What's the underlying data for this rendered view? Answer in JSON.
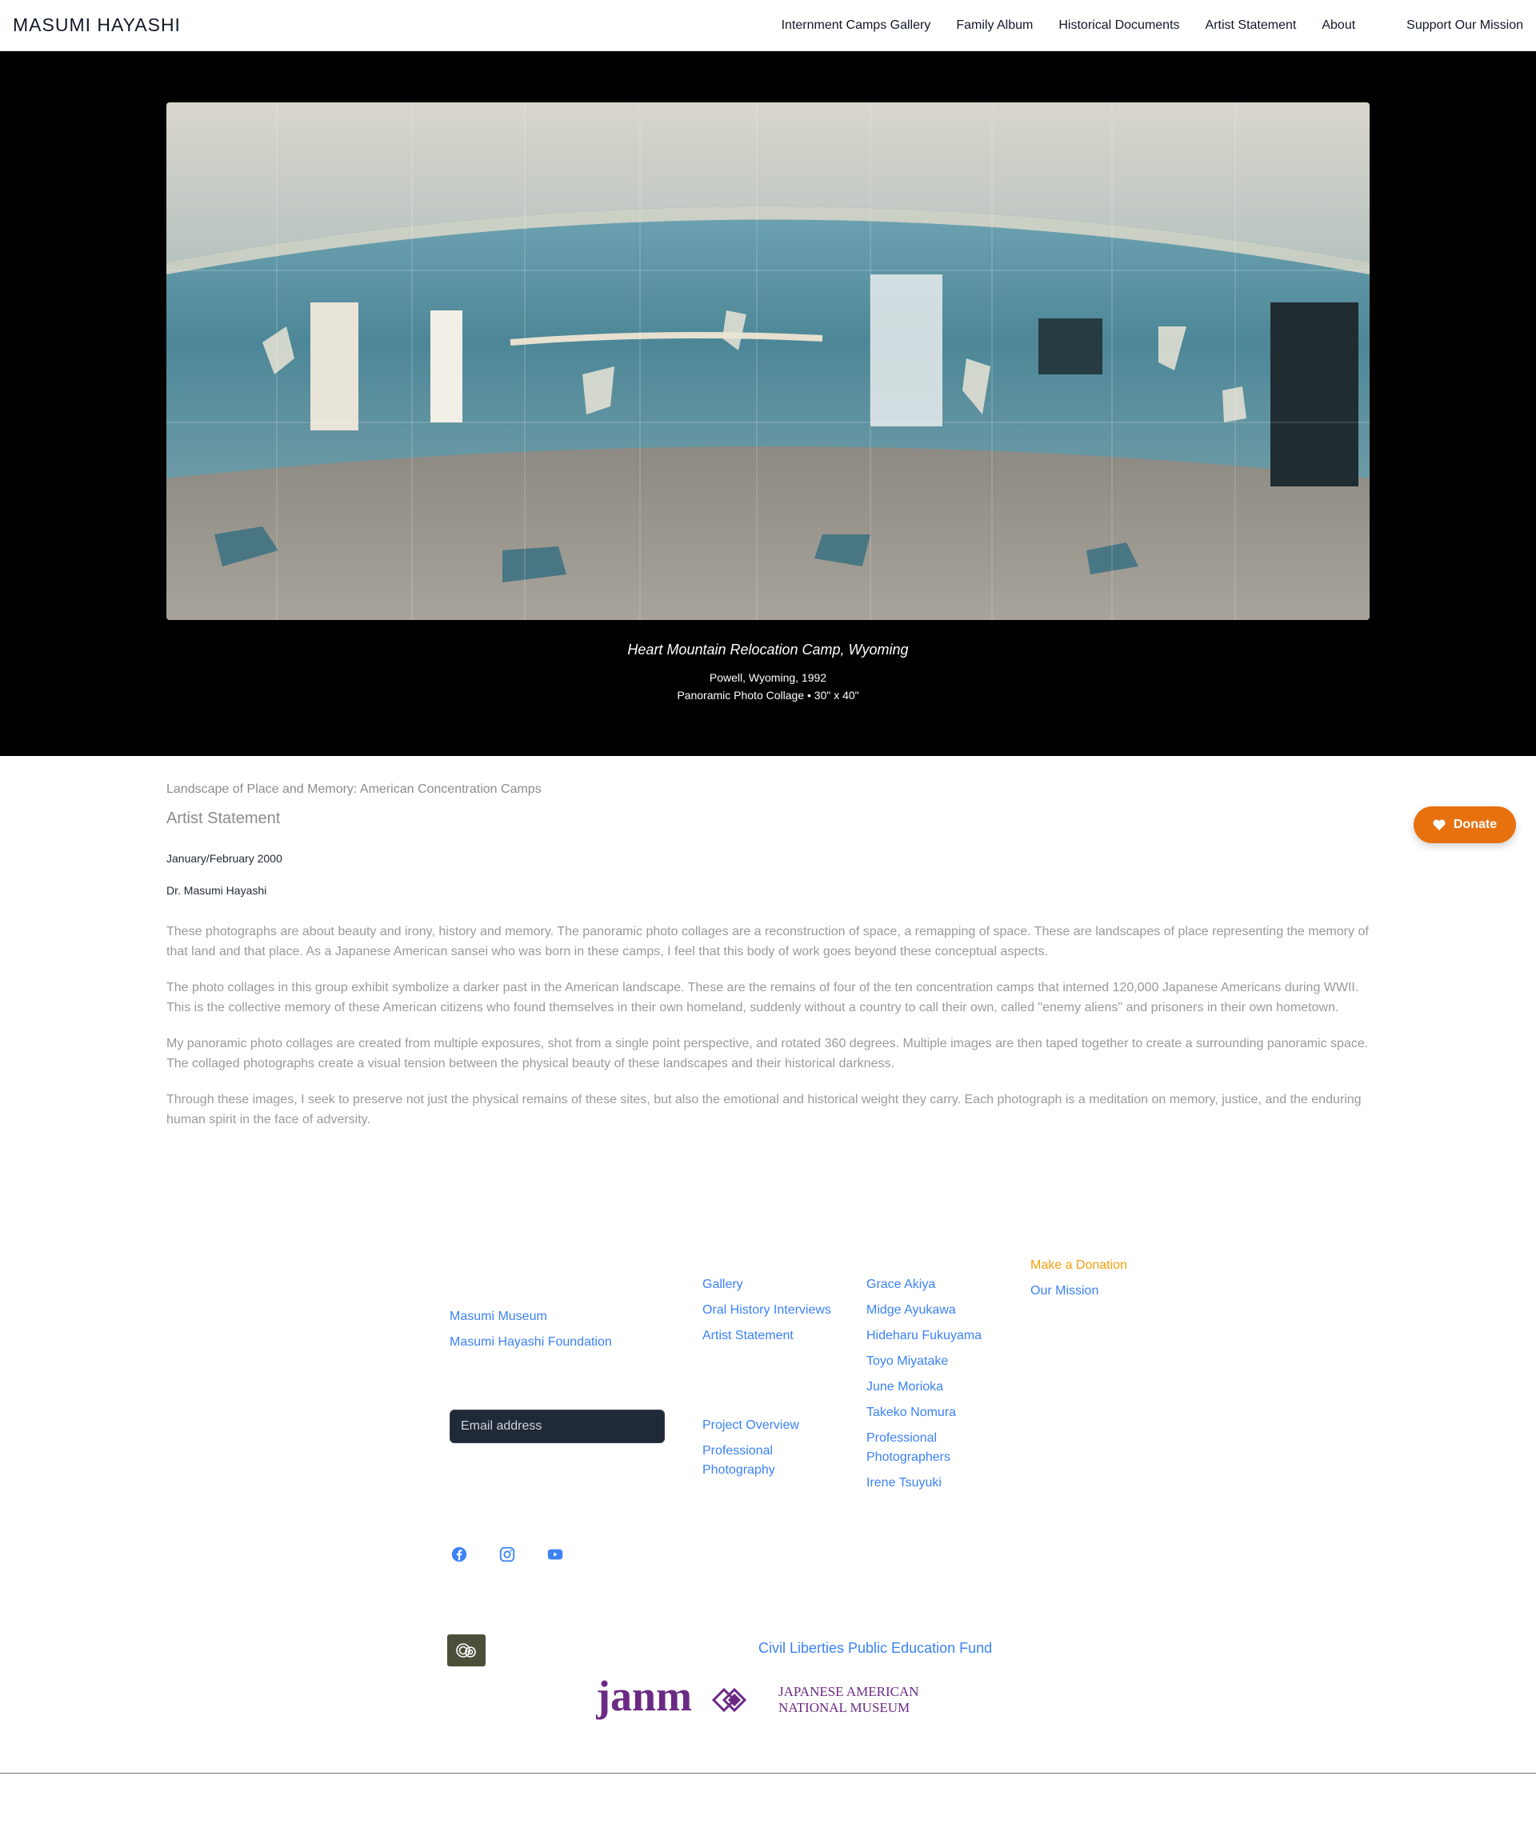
{
  "header": {
    "brand": "MASUMI HAYASHI",
    "nav": [
      "Internment Camps Gallery",
      "Family Album",
      "Historical Documents",
      "Artist Statement",
      "About"
    ],
    "support": "Support Our Mission"
  },
  "hero": {
    "title": "Heart Mountain Relocation Camp, Wyoming",
    "location": "Powell, Wyoming, 1992",
    "medium": "Panoramic Photo Collage • 30\" x 40\""
  },
  "statement": {
    "series": "Landscape of Place and Memory: American Concentration Camps",
    "heading": "Artist Statement",
    "date": "January/February 2000",
    "author": "Dr. Masumi Hayashi",
    "paragraphs": [
      "These photographs are about beauty and irony, history and memory. The panoramic photo collages are a reconstruction of space, a remapping of space. These are landscapes of place representing the memory of that land and that place. As a Japanese American sansei who was born in these camps, I feel that this body of work goes beyond these conceptual aspects.",
      "The photo collages in this group exhibit symbolize a darker past in the American landscape. These are the remains of four of the ten concentration camps that interned 120,000 Japanese Americans during WWII. This is the collective memory of these American citizens who found themselves in their own homeland, suddenly without a country to call their own, called \"enemy aliens\" and prisoners in their own hometown.",
      "My panoramic photo collages are created from multiple exposures, shot from a single point perspective, and rotated 360 degrees. Multiple images are then taped together to create a surrounding panoramic space. The collaged photographs create a visual tension between the physical beauty of these landscapes and their historical darkness.",
      "Through these images, I seek to preserve not just the physical remains of these sites, but also the emotional and historical weight they carry. Each photograph is a meditation on memory, justice, and the enduring human spirit in the face of adversity."
    ]
  },
  "donate": {
    "label": "Donate"
  },
  "footer": {
    "col1": [
      "Masumi Museum",
      "Masumi Hayashi Foundation"
    ],
    "email_placeholder": "Email address",
    "col2_top": [
      "Gallery",
      "Oral History Interviews",
      "Artist Statement"
    ],
    "col2_bottom": [
      "Project Overview",
      "Professional Photography"
    ],
    "col3": [
      "Grace Akiya",
      "Midge Ayukawa",
      "Hideharu Fukuyama",
      "Toyo Miyatake",
      "June Morioka",
      "Takeko Nomura",
      "Professional Photographers",
      "Irene Tsuyuki"
    ],
    "col4": [
      "Make a Donation",
      "Our Mission"
    ],
    "social": [
      "facebook-icon",
      "instagram-icon",
      "youtube-icon"
    ],
    "clpef": "Civil Liberties Public Education Fund",
    "janm": {
      "wordmark": "janm",
      "line1": "JAPANESE AMERICAN",
      "line2": "NATIONAL MUSEUM"
    }
  },
  "colors": {
    "accent_link": "#3b82f6",
    "donate": "#e8710f",
    "donation_link": "#f59e0b",
    "janm_purple": "#6b2a83"
  }
}
